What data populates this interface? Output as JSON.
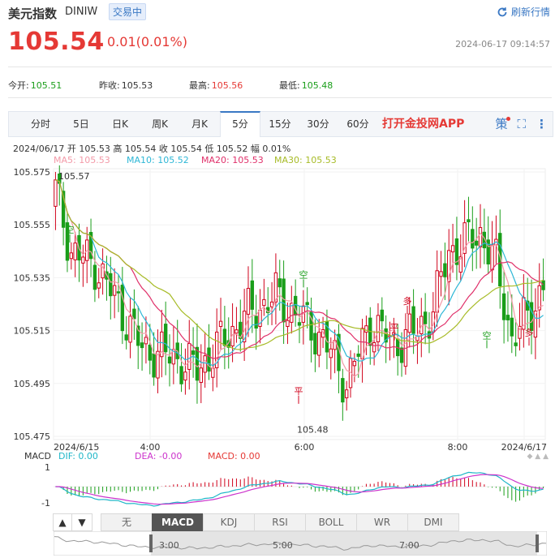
{
  "header": {
    "title": "美元指数",
    "code": "DINIW",
    "status_badge": "交易中",
    "refresh_label": "刷新行情",
    "price": "105.54",
    "change": "0.01(0.01%)",
    "timestamp": "2024-06-17 09:14:57"
  },
  "stats": {
    "open_label": "今开:",
    "open": "105.51",
    "prev_label": "昨收:",
    "prev": "105.53",
    "high_label": "最高:",
    "high": "105.56",
    "low_label": "最低:",
    "low": "105.48"
  },
  "tabs": [
    "分时",
    "5日",
    "日K",
    "周K",
    "月K",
    "5分",
    "15分",
    "30分",
    "60分"
  ],
  "active_tab": "5分",
  "app_link": "打开金投网APP",
  "ohlc_line": "2024/06/17  开 105.53  高 105.54  收 105.54  低 105.52  幅 0.01%",
  "ma_legend": [
    {
      "label": "MA5: 105.53",
      "color": "#f39aa8"
    },
    {
      "label": "MA10: 105.52",
      "color": "#2eb7d6"
    },
    {
      "label": "MA20: 105.53",
      "color": "#e0306a"
    },
    {
      "label": "MA30: 105.53",
      "color": "#a7bb27"
    }
  ],
  "macd_legend": {
    "title": "MACD",
    "dif": "DIF: 0.00",
    "dea": "DEA: -0.00",
    "macd": "MACD: 0.00"
  },
  "bottom_tabs": [
    "▲",
    "▼",
    "无",
    "MACD",
    "KDJ",
    "RSI",
    "BOLL",
    "WR",
    "DMI"
  ],
  "active_indicator": "MACD",
  "nav_labels": [
    "3:00",
    "5:00",
    "7:00"
  ],
  "colors": {
    "up": "#d0021b",
    "down": "#1a9e1a",
    "accent": "#3a78c4",
    "ma5": "#f39aa8",
    "ma10": "#2eb7d6",
    "ma20": "#e0306a",
    "ma30": "#a7bb27",
    "dif": "#1fb6c8",
    "dea": "#cc33cc"
  },
  "chart_data": {
    "type": "candlestick",
    "y_ticks": [
      "105.575",
      "105.555",
      "105.535",
      "105.515",
      "105.495",
      "105.475"
    ],
    "ylim": [
      105.475,
      105.575
    ],
    "x_ticks": [
      "2024/6/15",
      "4:00",
      "6:00",
      "8:00",
      "2024/6/17"
    ],
    "max_label": "105.57",
    "min_label": "105.48",
    "signals": [
      {
        "text": "空",
        "type": "short"
      },
      {
        "text": "空",
        "type": "short"
      },
      {
        "text": "平",
        "type": "close"
      },
      {
        "text": "多",
        "type": "long"
      },
      {
        "text": "平",
        "type": "close"
      },
      {
        "text": "空",
        "type": "short"
      },
      {
        "text": "多",
        "type": "long"
      }
    ],
    "macd_ylim": [
      -1,
      1
    ],
    "macd_ticks": [
      "1",
      "-1"
    ]
  }
}
